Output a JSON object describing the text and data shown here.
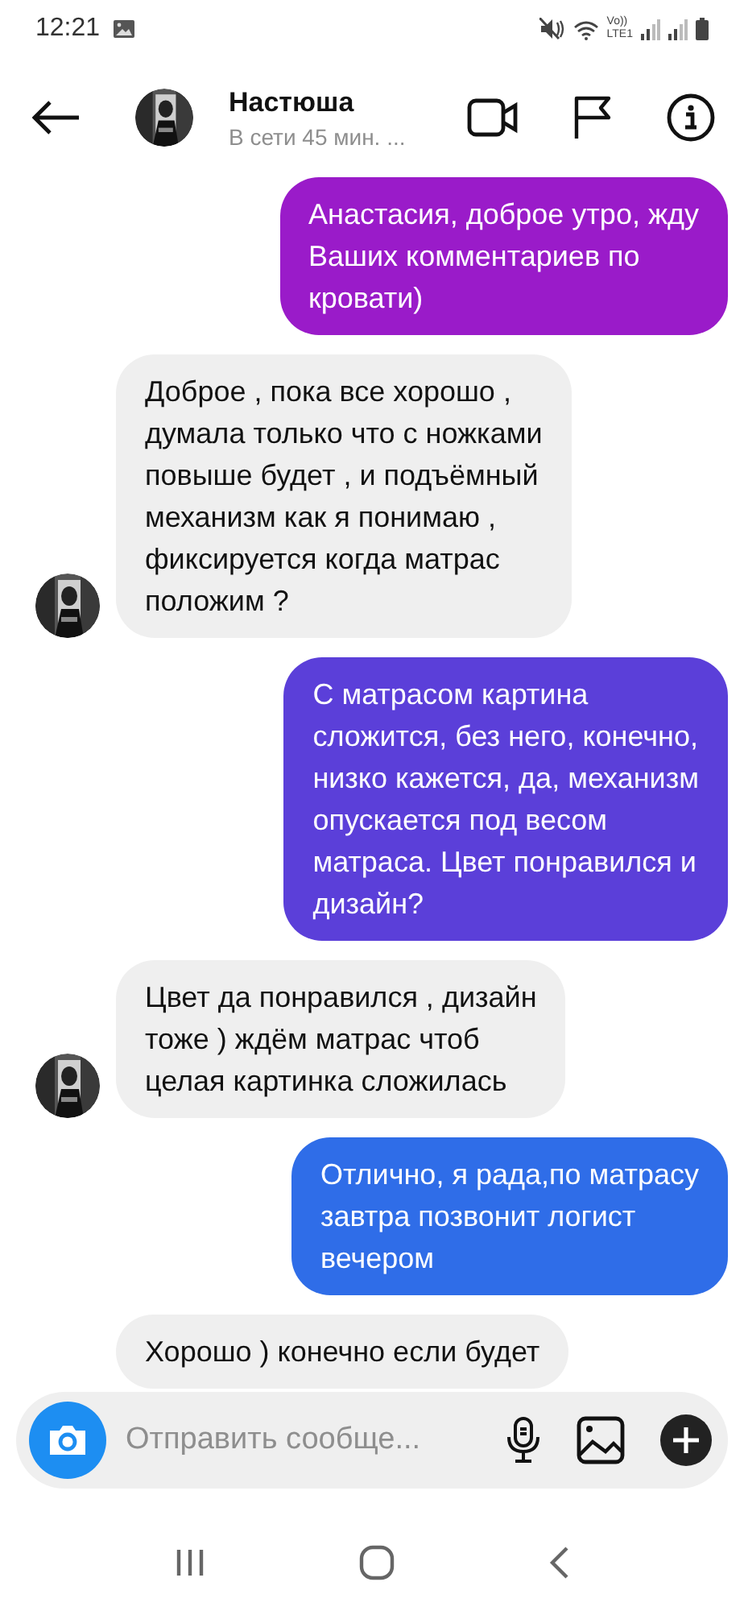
{
  "status_bar": {
    "time": "12:21",
    "volte": "Vo))",
    "network": "LTE1"
  },
  "header": {
    "name": "Настюша",
    "presence": "В сети 45 мин. ..."
  },
  "messages": [
    {
      "kind": "sent",
      "color": "#9a1bc9",
      "lines": [
        "Анастасия, доброе утро, жду",
        "Ваших комментариев по",
        "кровати)"
      ]
    },
    {
      "kind": "received",
      "color": "#efefef",
      "lines": [
        "Доброе , пока все хорошо ,",
        "думала только что с ножками",
        "повыше будет , и подъёмный",
        "механизм как я понимаю ,",
        "фиксируется когда матрас",
        "положим ?"
      ],
      "show_avatar": true
    },
    {
      "kind": "sent",
      "color": "#5b3fd9",
      "lines": [
        "С матрасом картина",
        "сложится, без него, конечно,",
        "низко кажется, да, механизм",
        "опускается под весом",
        "матраса. Цвет понравился и",
        "дизайн?"
      ]
    },
    {
      "kind": "received",
      "color": "#efefef",
      "lines": [
        "Цвет да понравился , дизайн",
        "тоже ) ждём матрас чтоб",
        "целая картинка сложилась"
      ],
      "show_avatar": true
    },
    {
      "kind": "sent",
      "color": "#2f6de8",
      "lines": [
        "Отлично, я рада,по матрасу",
        "завтра позвонит логист",
        "вечером"
      ]
    },
    {
      "kind": "received",
      "color": "#efefef",
      "lines": [
        "Хорошо ) конечно если будет"
      ],
      "show_avatar": false
    }
  ],
  "composer": {
    "placeholder": "Отправить сообще..."
  }
}
